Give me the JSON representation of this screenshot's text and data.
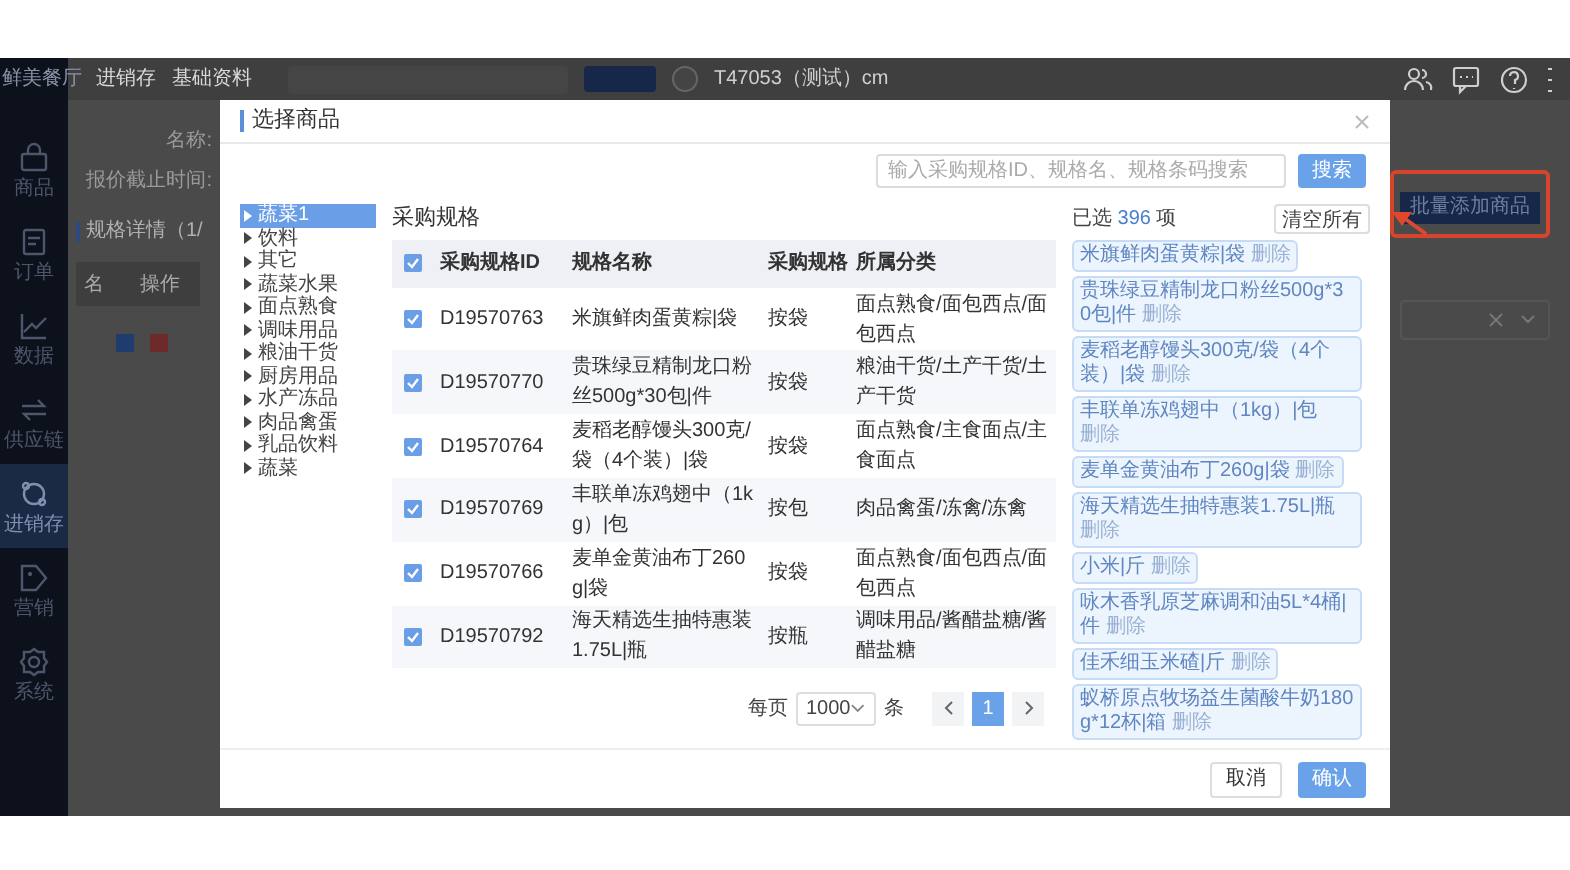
{
  "app": {
    "logo": "鲜美餐厅"
  },
  "sidebar": {
    "items": [
      {
        "label": "商品",
        "selected": false
      },
      {
        "label": "订单",
        "selected": false
      },
      {
        "label": "数据",
        "selected": false
      },
      {
        "label": "供应链",
        "selected": false
      },
      {
        "label": "进销存",
        "selected": true
      },
      {
        "label": "营销",
        "selected": false
      },
      {
        "label": "系统",
        "selected": false
      }
    ]
  },
  "top_bar": {
    "breadcrumbs": [
      "进销存",
      "基础资料"
    ],
    "user": "T47053（测试）cm"
  },
  "page": {
    "fields": [
      "名称:",
      "报价截止时间:"
    ],
    "section_title": "规格详情（1/",
    "columns": [
      "名",
      "操作"
    ],
    "batch_add_button": "批量添加商品"
  },
  "dialog": {
    "title": "选择商品",
    "search": {
      "placeholder": "输入采购规格ID、规格名、规格条码搜索",
      "button": "搜索"
    },
    "categories": [
      {
        "label": "蔬菜1",
        "selected": true
      },
      {
        "label": "饮料",
        "selected": false
      },
      {
        "label": "其它",
        "selected": false
      },
      {
        "label": "蔬菜水果",
        "selected": false
      },
      {
        "label": "面点熟食",
        "selected": false
      },
      {
        "label": "调味用品",
        "selected": false
      },
      {
        "label": "粮油干货",
        "selected": false
      },
      {
        "label": "厨房用品",
        "selected": false
      },
      {
        "label": "水产冻品",
        "selected": false
      },
      {
        "label": "肉品禽蛋",
        "selected": false
      },
      {
        "label": "乳品饮料",
        "selected": false
      },
      {
        "label": "蔬菜",
        "selected": false
      }
    ],
    "table": {
      "title": "采购规格",
      "all_checked": true,
      "columns": [
        "采购规格ID",
        "规格名称",
        "采购规格",
        "所属分类"
      ],
      "rows": [
        {
          "id": "D19570763",
          "name": "米旗鲜肉蛋黄粽|袋",
          "unit": "按袋",
          "category": "面点熟食/面包西点/面包西点",
          "checked": true
        },
        {
          "id": "D19570770",
          "name": "贵珠绿豆精制龙口粉丝500g*30包|件",
          "unit": "按袋",
          "category": "粮油干货/土产干货/土产干货",
          "checked": true
        },
        {
          "id": "D19570764",
          "name": "麦稻老醇馒头300克/袋（4个装）|袋",
          "unit": "按袋",
          "category": "面点熟食/主食面点/主食面点",
          "checked": true
        },
        {
          "id": "D19570769",
          "name": "丰联单冻鸡翅中（1kg）|包",
          "unit": "按包",
          "category": "肉品禽蛋/冻禽/冻禽",
          "checked": true
        },
        {
          "id": "D19570766",
          "name": "麦单金黄油布丁260g|袋",
          "unit": "按袋",
          "category": "面点熟食/面包西点/面包西点",
          "checked": true
        },
        {
          "id": "D19570792",
          "name": "海天精选生抽特惠装1.75L|瓶",
          "unit": "按瓶",
          "category": "调味用品/酱醋盐糖/酱醋盐糖",
          "checked": true
        }
      ]
    },
    "pagination": {
      "per_page_label": "每页",
      "page_size": "1000",
      "unit": "条",
      "pages": [
        {
          "label": "1",
          "selected": true
        }
      ]
    },
    "selected_panel": {
      "prefix": "已选",
      "count": "396",
      "suffix": "项",
      "clear_button": "清空所有",
      "chips": [
        {
          "label": "米旗鲜肉蛋黄粽|袋",
          "remove": "删除"
        },
        {
          "label": "贵珠绿豆精制龙口粉丝500g*30包|件",
          "remove": "删除"
        },
        {
          "label": "麦稻老醇馒头300克/袋（4个装）|袋",
          "remove": "删除"
        },
        {
          "label": "丰联单冻鸡翅中（1kg）|包",
          "remove": "删除"
        },
        {
          "label": "麦单金黄油布丁260g|袋",
          "remove": "删除"
        },
        {
          "label": "海天精选生抽特惠装1.75L|瓶",
          "remove": "删除"
        },
        {
          "label": "小米|斤",
          "remove": "删除"
        },
        {
          "label": "咏木香乳原芝麻调和油5L*4桶|件",
          "remove": "删除"
        },
        {
          "label": "佳禾细玉米碴|斤",
          "remove": "删除"
        },
        {
          "label": "蚁桥原点牧场益生菌酸牛奶180g*12杯|箱",
          "remove": "删除"
        }
      ]
    },
    "buttons": [
      {
        "label": "取消",
        "kind": "default"
      },
      {
        "label": "确认",
        "kind": "primary"
      }
    ]
  }
}
